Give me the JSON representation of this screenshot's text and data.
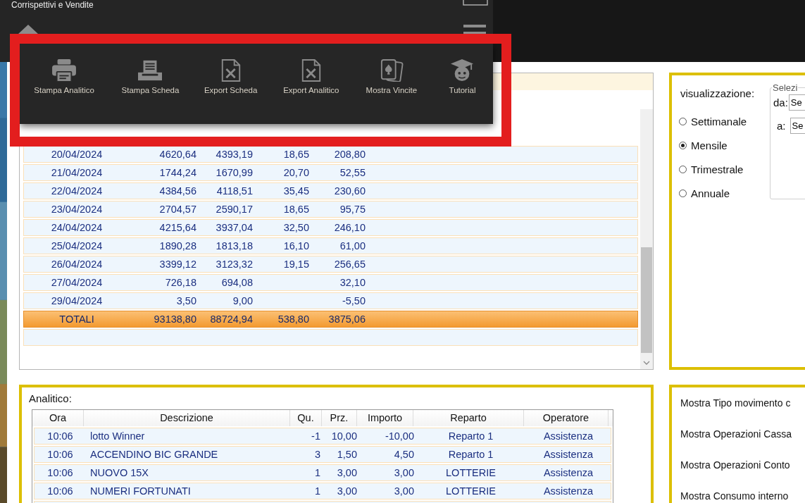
{
  "window": {
    "title": "Corrispettivi e Vendite"
  },
  "overlay_menu": {
    "items": [
      {
        "label": "Stampa Analitico",
        "kind": "printer"
      },
      {
        "label": "Stampa Scheda",
        "kind": "receipt"
      },
      {
        "label": "Export Scheda",
        "kind": "excel"
      },
      {
        "label": "Export Analitico",
        "kind": "excel"
      },
      {
        "label": "Mostra Vincite",
        "kind": "cards"
      },
      {
        "label": "Tutorial",
        "kind": "student"
      }
    ]
  },
  "summary_table": {
    "rows": [
      {
        "kind": "day",
        "data": "20/04/2024",
        "totale": "4620,64",
        "iva_0": "4393,19",
        "iva_10": "18,65",
        "iva_22": "208,80"
      },
      {
        "kind": "day",
        "data": "21/04/2024",
        "totale": "1744,24",
        "iva_0": "1670,99",
        "iva_10": "20,70",
        "iva_22": "52,55"
      },
      {
        "kind": "day",
        "data": "22/04/2024",
        "totale": "4384,56",
        "iva_0": "4118,51",
        "iva_10": "35,45",
        "iva_22": "230,60"
      },
      {
        "kind": "day",
        "data": "23/04/2024",
        "totale": "2704,57",
        "iva_0": "2590,17",
        "iva_10": "18,65",
        "iva_22": "95,75"
      },
      {
        "kind": "day",
        "data": "24/04/2024",
        "totale": "4215,64",
        "iva_0": "3937,04",
        "iva_10": "32,50",
        "iva_22": "246,10"
      },
      {
        "kind": "day",
        "data": "25/04/2024",
        "totale": "1890,28",
        "iva_0": "1813,18",
        "iva_10": "16,10",
        "iva_22": "61,00"
      },
      {
        "kind": "day",
        "data": "26/04/2024",
        "totale": "3399,12",
        "iva_0": "3123,32",
        "iva_10": "19,15",
        "iva_22": "256,65"
      },
      {
        "kind": "day",
        "data": "27/04/2024",
        "totale": "726,18",
        "iva_0": "694,08",
        "iva_22": "32,10"
      },
      {
        "kind": "day",
        "data": "29/04/2024",
        "totale": "3,50",
        "iva_0": "9,00",
        "iva_22": "-5,50"
      },
      {
        "kind": "total",
        "data": "TOTALI",
        "totale": "93138,80",
        "iva_0": "88724,94",
        "iva_10": "538,80",
        "iva_22": "3875,06"
      },
      {
        "kind": "empty"
      }
    ]
  },
  "visualizzazione": {
    "title": "visualizzazione:",
    "options": [
      {
        "label": "Settimanale",
        "selected": false
      },
      {
        "label": "Mensile",
        "selected": true
      },
      {
        "label": "Trimestrale",
        "selected": false
      },
      {
        "label": "Annuale",
        "selected": false
      }
    ]
  },
  "selezione": {
    "legend": "Selezi",
    "from_label": "da:",
    "from_value": "Se",
    "to_label": "a:",
    "to_value": "Se"
  },
  "analitico": {
    "title": "Analitico:",
    "columns": [
      "Ora",
      "Descrizione",
      "Qu.",
      "Prz.",
      "Importo",
      "Reparto",
      "Operatore"
    ],
    "rows": [
      [
        "10:06",
        "lotto Winner",
        "-1",
        "10,00",
        "-10,00",
        "Reparto 1",
        "Assistenza"
      ],
      [
        "10:06",
        "ACCENDINO BIC GRANDE",
        "3",
        "1,50",
        "4,50",
        "Reparto 1",
        "Assistenza"
      ],
      [
        "10:06",
        "NUOVO 15X",
        "1",
        "3,00",
        "3,00",
        "LOTTERIE",
        "Assistenza"
      ],
      [
        "10:06",
        "NUMERI FORTUNATI",
        "1",
        "3,00",
        "3,00",
        "LOTTERIE",
        "Assistenza"
      ]
    ]
  },
  "filters": {
    "items": [
      "Mostra Tipo movimento c",
      "Mostra Operazioni Cassa",
      "Mostra Operazioni Conto",
      "Mostra Consumo interno"
    ]
  }
}
